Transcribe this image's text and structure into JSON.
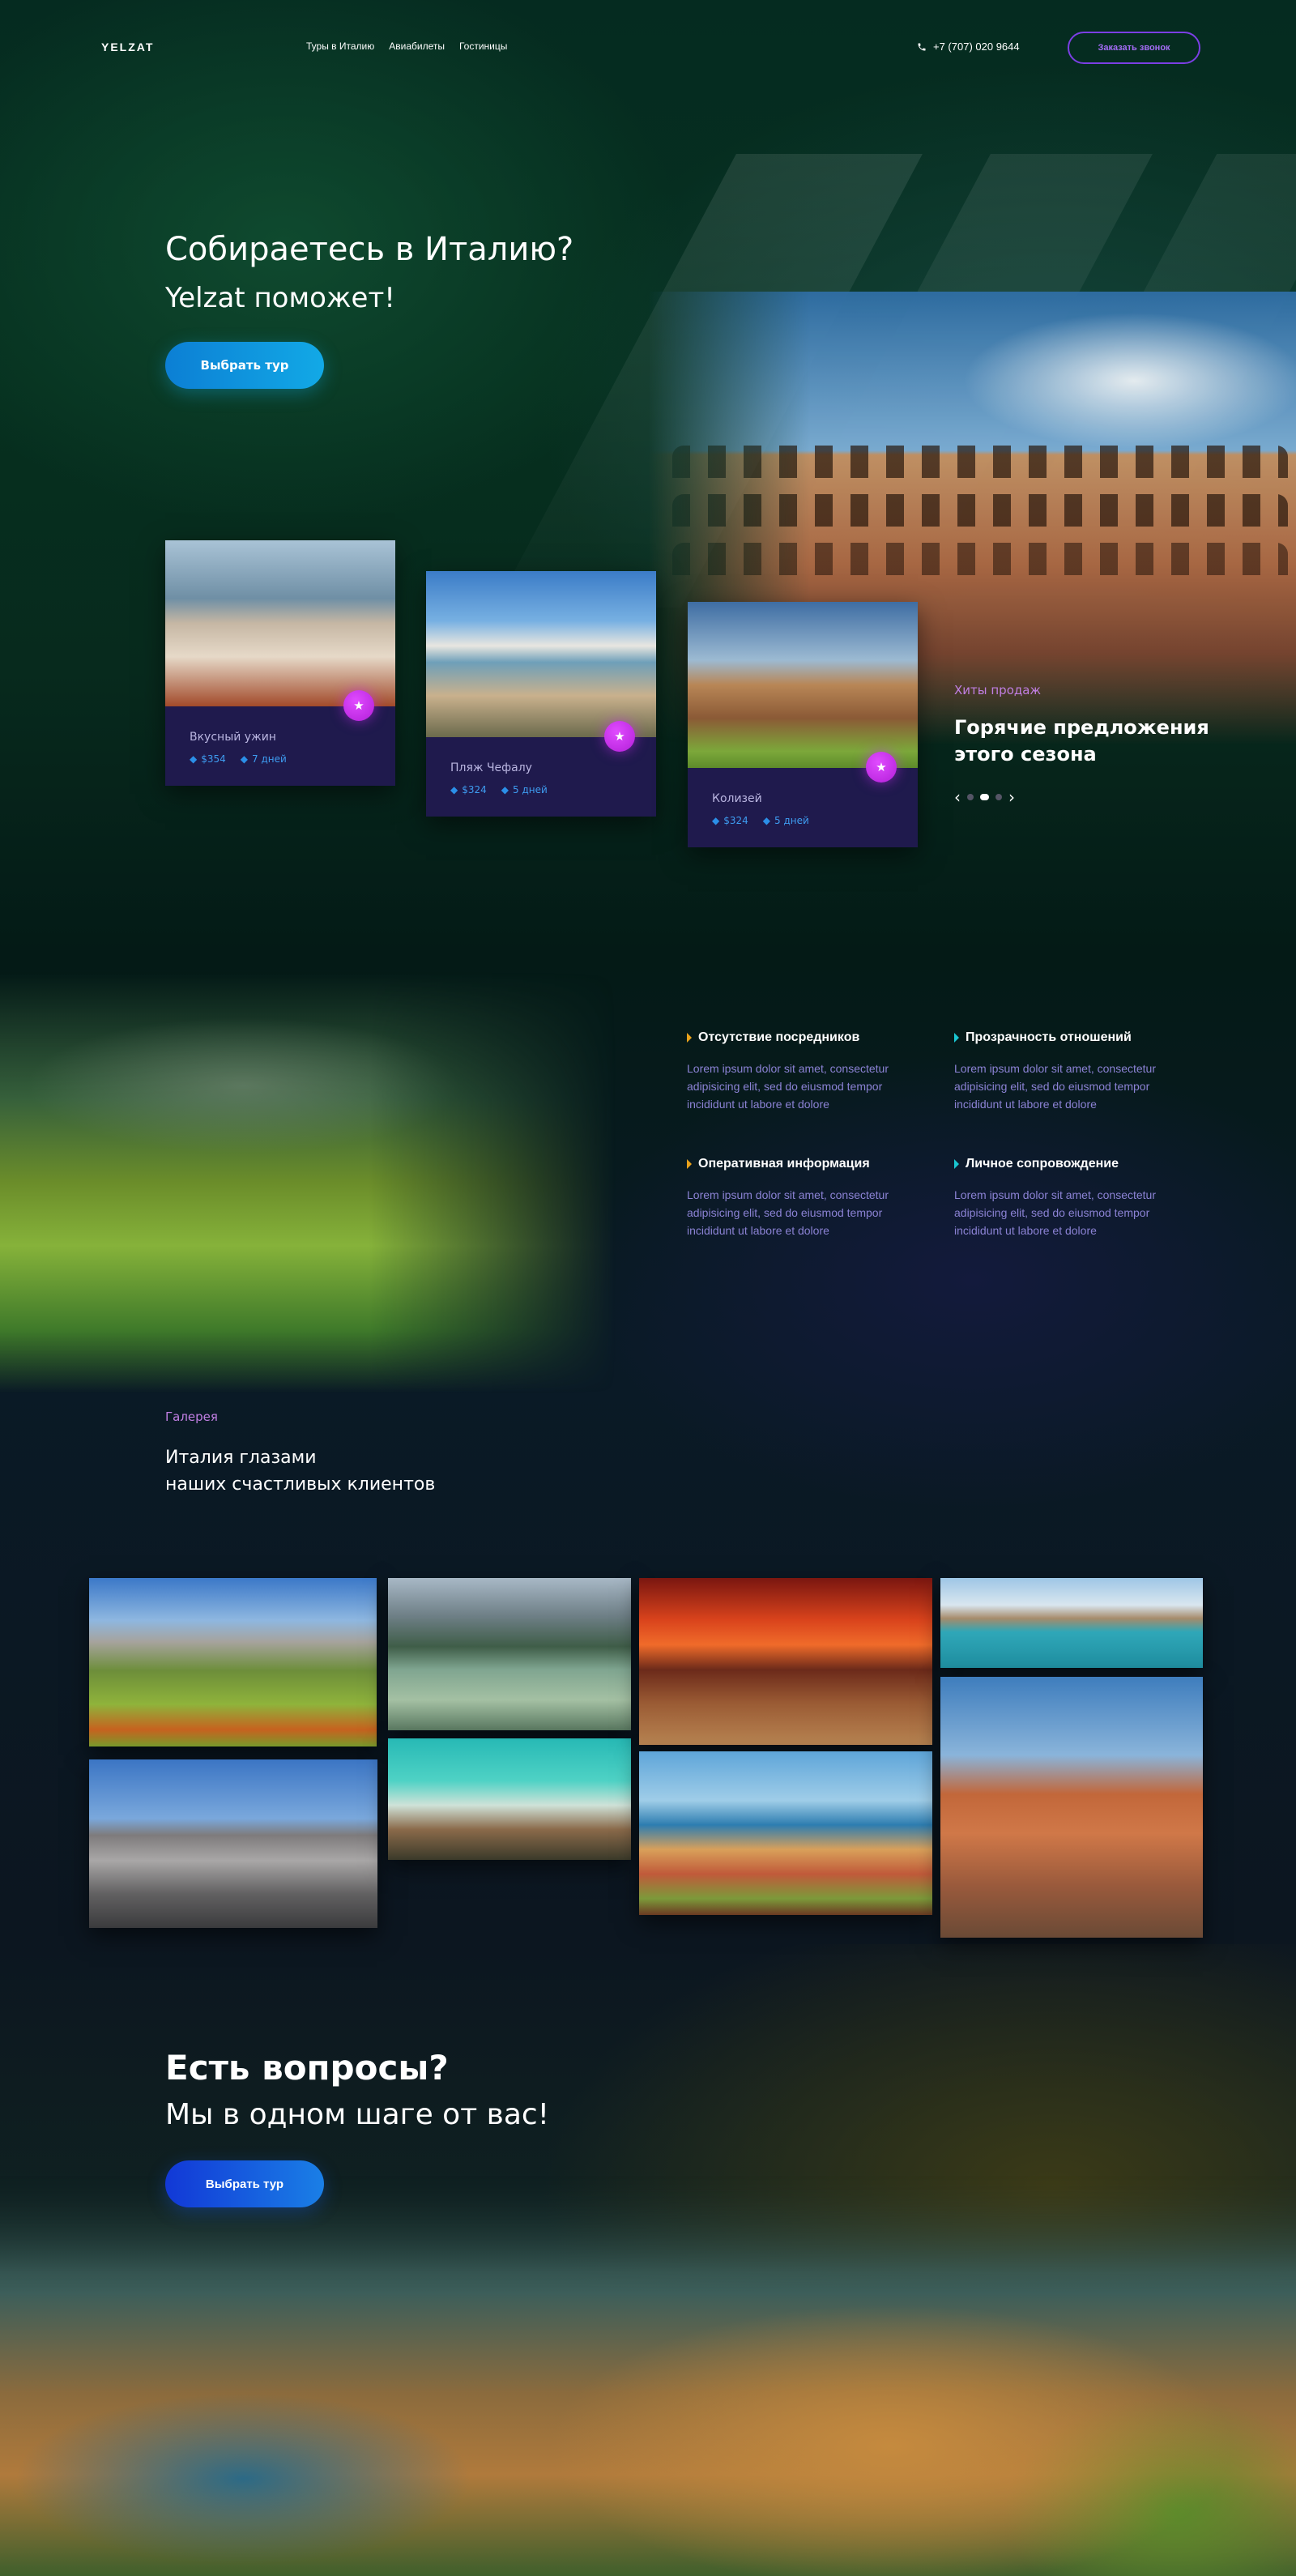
{
  "header": {
    "logo": "YELZAT",
    "nav": [
      "Туры в Италию",
      "Авиабилеты",
      "Гостиницы"
    ],
    "phone": "+7 (707) 020 9644",
    "callback_label": "Заказать звонок"
  },
  "hero": {
    "title": "Собираетесь в Италию?",
    "subtitle": "Yelzat поможет!",
    "button_label": "Выбрать тур"
  },
  "tours": [
    {
      "name": "Вкусный ужин",
      "price": "$354",
      "duration": "7 дней"
    },
    {
      "name": "Пляж Чефалу",
      "price": "$324",
      "duration": "5 дней"
    },
    {
      "name": "Колизей",
      "price": "$324",
      "duration": "5 дней"
    }
  ],
  "hot_offers": {
    "label": "Хиты продаж",
    "title": "Горячие предложения этого сезона",
    "slider": {
      "count": 3,
      "active": 2
    }
  },
  "features": [
    {
      "title": "Отсутствие посредников",
      "text": "Lorem ipsum dolor sit amet, consectetur adipisicing elit, sed do eiusmod tempor incididunt ut labore et dolore",
      "marker_color": "#e9a21b"
    },
    {
      "title": "Прозрачность отношений",
      "text": "Lorem ipsum dolor sit amet, consectetur adipisicing elit, sed do eiusmod tempor incididunt ut labore et dolore",
      "marker_color": "#19c6d1"
    },
    {
      "title": "Оперативная информация",
      "text": "Lorem ipsum dolor sit amet, consectetur adipisicing elit, sed do eiusmod tempor incididunt ut labore et dolore",
      "marker_color": "#e9a21b"
    },
    {
      "title": "Личное сопровождение",
      "text": "Lorem ipsum dolor sit amet, consectetur adipisicing elit, sed do eiusmod tempor incididunt ut labore et dolore",
      "marker_color": "#19c6d1"
    }
  ],
  "gallery": {
    "label": "Галерея",
    "title": "Италия глазами\nнаших счастливых клиентов"
  },
  "contact": {
    "title": "Есть вопросы?",
    "subtitle": "Мы в одном шаге от вас!",
    "button_label": "Выбрать тур"
  },
  "colors": {
    "accent_purple": "#b21fd8",
    "accent_blue": "#12a9e6",
    "card_bg": "#1f1a4d",
    "label_pink": "#c17fe3"
  },
  "icons": {
    "phone": "phone-icon",
    "favorite": "star-icon",
    "price": "tag-icon",
    "duration": "tag-icon"
  }
}
